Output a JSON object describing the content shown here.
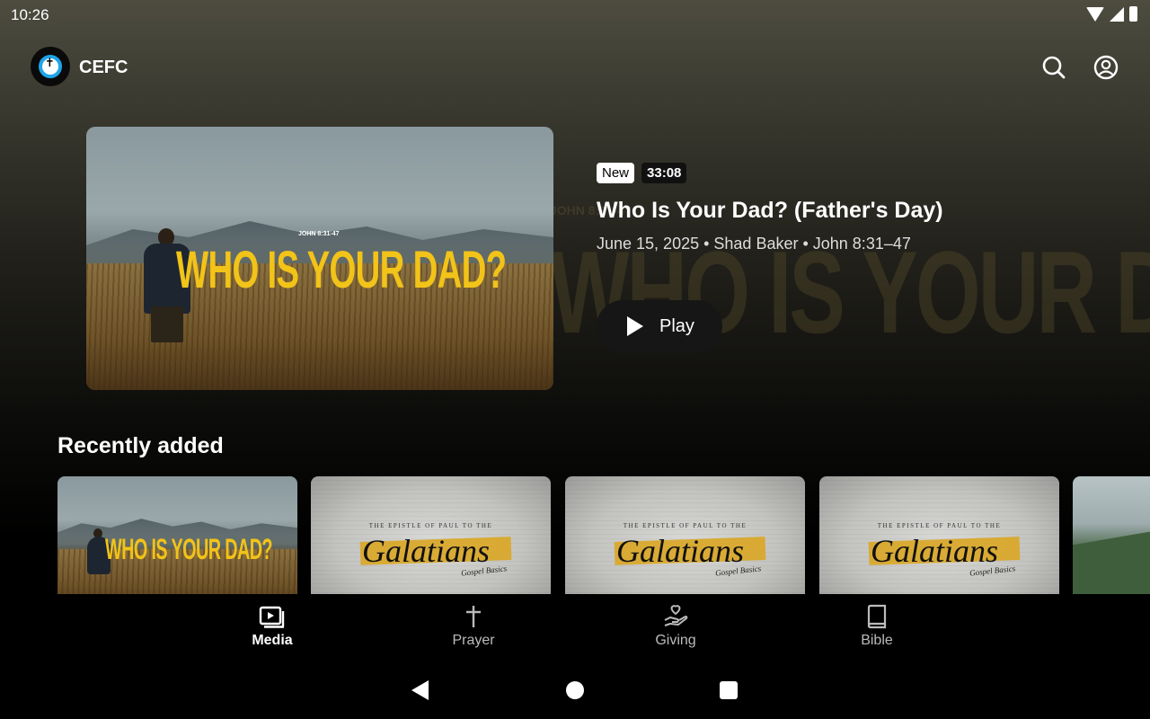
{
  "status_bar": {
    "time": "10:26"
  },
  "app_bar": {
    "brand": "CEFC"
  },
  "hero": {
    "thumb_title": "WHO IS YOUR DAD?",
    "thumb_ref": "JOHN 8:31-47",
    "badge_new": "New",
    "duration": "33:08",
    "title": "Who Is Your Dad? (Father's Day)",
    "meta": "June 15, 2025 • Shad Baker • John 8:31–47",
    "play_label": "Play"
  },
  "recently_added": {
    "title": "Recently added",
    "cards": [
      {
        "kind": "dad",
        "title": "WHO IS YOUR DAD?"
      },
      {
        "kind": "galatians",
        "epistle": "THE EPISTLE OF PAUL TO THE",
        "title": "Galatians",
        "sub": "Gospel Basics"
      },
      {
        "kind": "galatians",
        "epistle": "THE EPISTLE OF PAUL TO THE",
        "title": "Galatians",
        "sub": "Gospel Basics"
      },
      {
        "kind": "galatians",
        "epistle": "THE EPISTLE OF PAUL TO THE",
        "title": "Galatians",
        "sub": "Gospel Basics"
      },
      {
        "kind": "mountain"
      }
    ]
  },
  "bottom_nav": {
    "items": [
      {
        "label": "Media",
        "icon": "media-icon",
        "active": true
      },
      {
        "label": "Prayer",
        "icon": "cross-icon",
        "active": false
      },
      {
        "label": "Giving",
        "icon": "giving-hand-icon",
        "active": false
      },
      {
        "label": "Bible",
        "icon": "book-icon",
        "active": false
      }
    ]
  },
  "colors": {
    "accent_yellow": "#f2c318",
    "logo_blue": "#1ea5e8",
    "tape_gold": "#d9a92c"
  }
}
